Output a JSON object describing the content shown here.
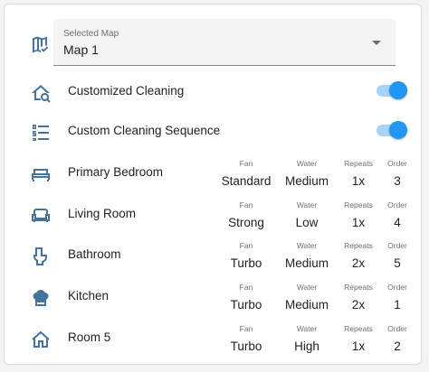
{
  "colors": {
    "icon": "#44739e",
    "toggle_on": "#2196f3",
    "toggle_track": "#a9d3f5"
  },
  "map_select": {
    "label": "Selected Map",
    "value": "Map 1",
    "icon": "map-check-icon"
  },
  "customized_cleaning": {
    "label": "Customized Cleaning",
    "icon": "home-search-icon",
    "enabled": true
  },
  "custom_sequence": {
    "label": "Custom Cleaning Sequence",
    "icon": "order-list-icon",
    "enabled": true
  },
  "columns": {
    "fan": "Fan",
    "water": "Water",
    "repeats": "Repeats",
    "order": "Order"
  },
  "rooms": [
    {
      "name": "Primary Bedroom",
      "icon": "bed-icon",
      "fan": "Standard",
      "water": "Medium",
      "repeats": "1x",
      "order": "3"
    },
    {
      "name": "Living Room",
      "icon": "sofa-icon",
      "fan": "Strong",
      "water": "Low",
      "repeats": "1x",
      "order": "4"
    },
    {
      "name": "Bathroom",
      "icon": "toilet-icon",
      "fan": "Turbo",
      "water": "Medium",
      "repeats": "2x",
      "order": "5"
    },
    {
      "name": "Kitchen",
      "icon": "chef-hat-icon",
      "fan": "Turbo",
      "water": "Medium",
      "repeats": "2x",
      "order": "1"
    },
    {
      "name": "Room 5",
      "icon": "home-icon",
      "fan": "Turbo",
      "water": "High",
      "repeats": "1x",
      "order": "2"
    }
  ]
}
